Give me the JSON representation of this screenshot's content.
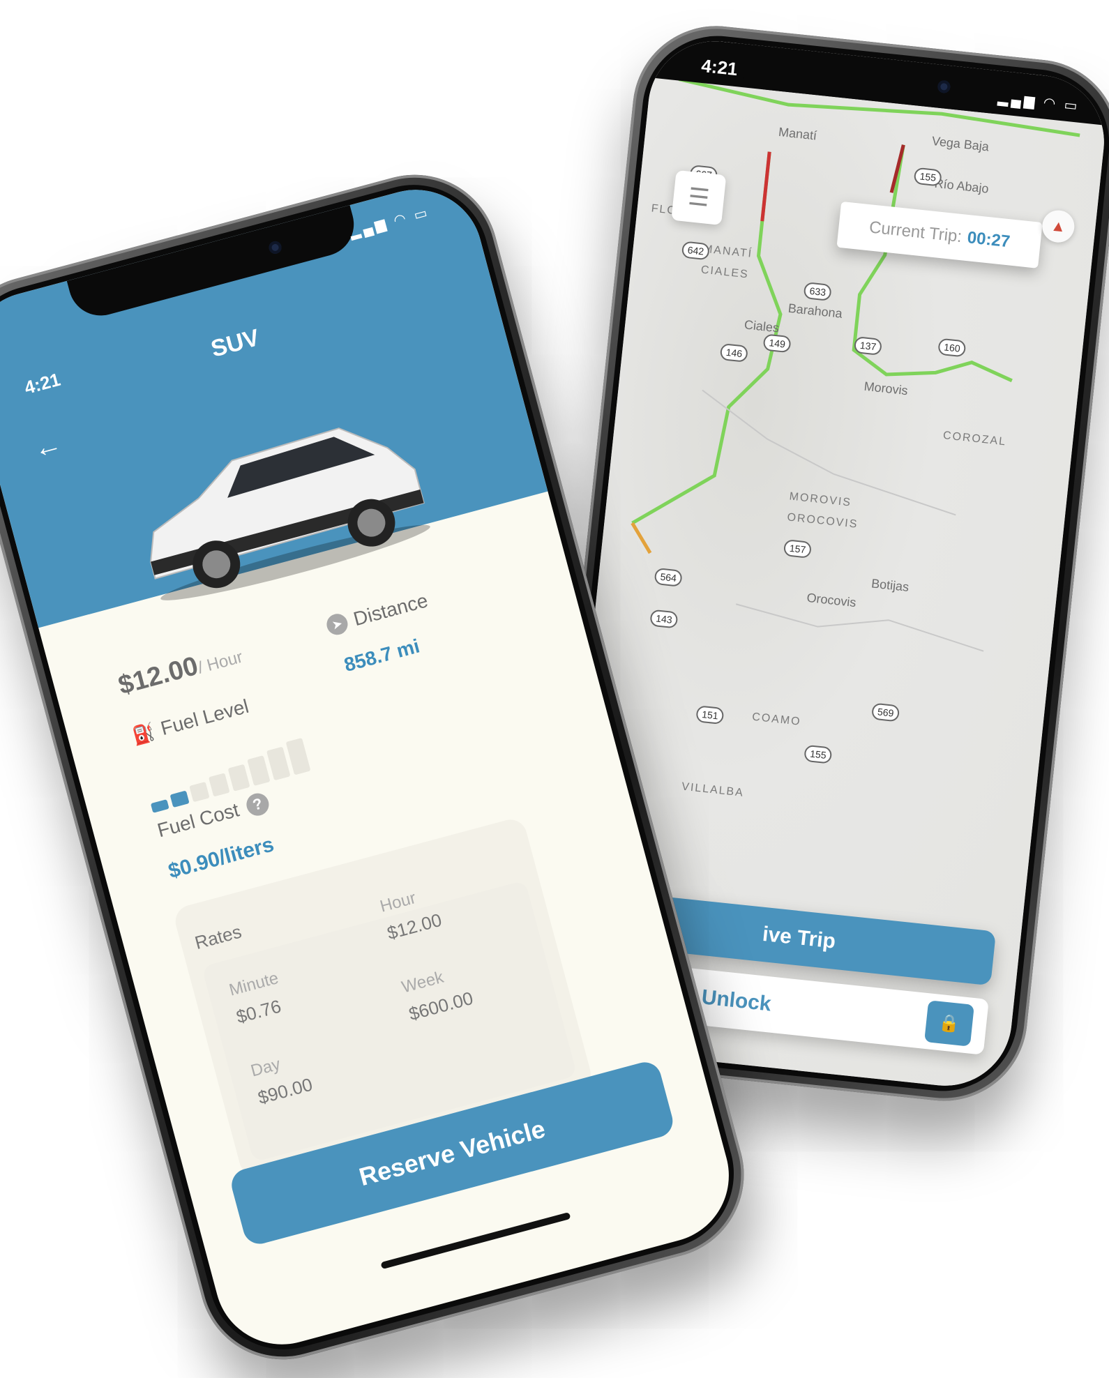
{
  "map_phone": {
    "status_time": "4:21",
    "status_icons": "▂▄▆ ◠ ▭",
    "menu_icon": "☰",
    "current_trip_label": "Current Trip:",
    "current_trip_value": "00:27",
    "compass_icon": "▲",
    "trip_button_label": "ive Trip",
    "unlock_label": "Unlock",
    "lock_icon": "🔒",
    "places": [
      "Manatí",
      "Vega Baja",
      "Río Abajo",
      "MANATÍ",
      "CIALES",
      "Barahona",
      "Ciales",
      "Morovis",
      "MOROVIS",
      "OROCOVIS",
      "Botijas",
      "Orocovis",
      "COAMO",
      "VILLALBA",
      "COROZAL",
      "FLORIDA",
      "Coam"
    ],
    "route_shields": [
      "667",
      "642",
      "633",
      "137",
      "155",
      "160",
      "146",
      "149",
      "157",
      "564",
      "143",
      "151",
      "155",
      "569"
    ]
  },
  "vehicle_phone": {
    "status_time": "4:21",
    "status_icons": "▂▄▆ ◠ ▭",
    "title": "SUV",
    "back_icon": "←",
    "price": "$12.00",
    "price_unit": "/ Hour",
    "distance_label": "Distance",
    "distance_value": "858.7 mi",
    "fuel_level_label": "Fuel Level",
    "fuel_level_fraction": 0.25,
    "fuel_cost_label": "Fuel Cost",
    "fuel_cost_value": "$0.90/liters",
    "rates_title": "Rates",
    "rates": {
      "minute_label": "Minute",
      "minute_value": "$0.76",
      "hour_label": "Hour",
      "hour_value": "$12.00",
      "day_label": "Day",
      "day_value": "$90.00",
      "week_label": "Week",
      "week_value": "$600.00"
    },
    "reserve_label": "Reserve Vehicle"
  },
  "colors": {
    "accent": "#4a93bd",
    "cream": "#fbfaf1"
  }
}
